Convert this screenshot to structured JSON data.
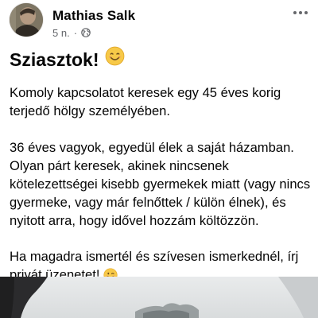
{
  "post": {
    "author": "Mathias Salk",
    "time": "5 n.",
    "separator": "·",
    "privacy_icon": "globe-icon",
    "more_icon": "more-options-icon",
    "greeting_text": "Sziasztok!",
    "greeting_emoji": "smiling-face-emoji",
    "paragraphs": [
      "Komoly kapcsolatot keresek egy 45 éves korig terjedő hölgy személyében.",
      "36 éves vagyok, egyedül élek a saját házamban. Olyan párt keresek, akinek nincsenek kötelezettségei kisebb gyermekek miatt (vagy nincs gyermeke, vagy már felnőttek / külön élnek), és nyitott arra, hogy idővel hozzám költözzön.",
      "Ha magadra ismertél és szívesen ismerkednél, írj privát üzenetet!"
    ],
    "closing_emoji": "winking-face-emoji",
    "photo_label": "post-photo"
  },
  "colors": {
    "text": "#050505",
    "secondary_text": "#65676b",
    "emoji_yellow": "#f7c948",
    "emoji_outline": "#e0a526"
  }
}
